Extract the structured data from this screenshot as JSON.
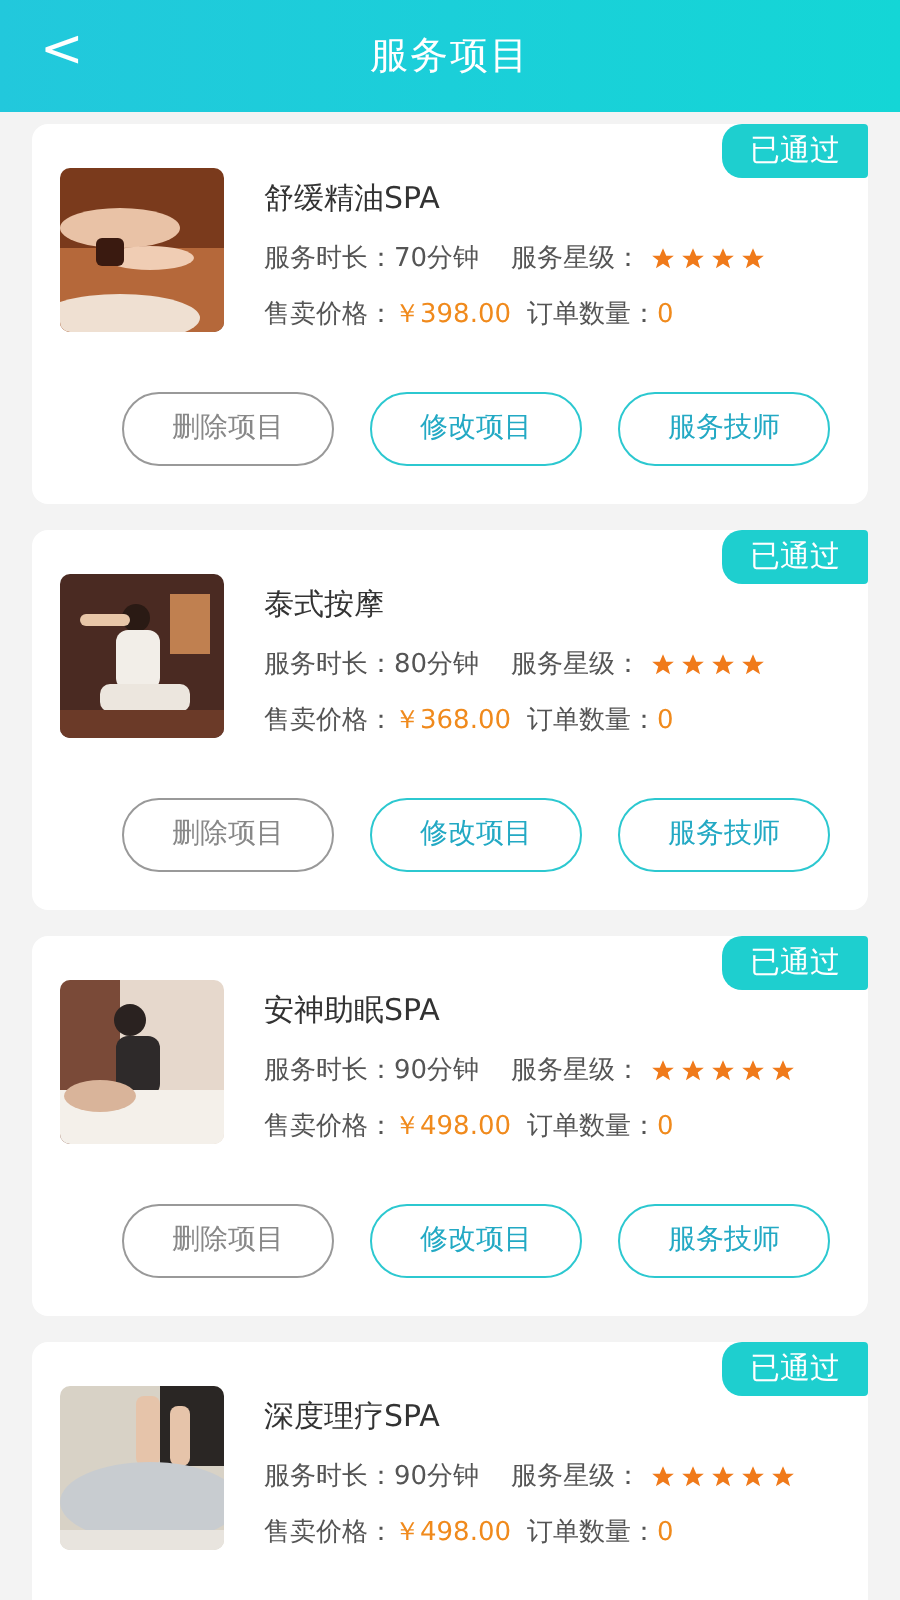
{
  "header": {
    "back": "<",
    "title": "服务项目"
  },
  "items": [
    {
      "status": "已通过",
      "name": "舒缓精油SPA",
      "duration_label": "服务时长：",
      "duration": "70分钟",
      "stars_label": "服务星级：",
      "stars": 4,
      "price_label": "售卖价格：",
      "price": "￥398.00",
      "orders_label": "订单数量：",
      "orders": "0",
      "buttons": [
        {
          "label": "删除项目",
          "kind": "delete"
        },
        {
          "label": "修改项目",
          "kind": "edit"
        },
        {
          "label": "服务技师",
          "kind": "staff"
        }
      ]
    },
    {
      "status": "已通过",
      "name": "泰式按摩",
      "duration_label": "服务时长：",
      "duration": "80分钟",
      "stars_label": "服务星级：",
      "stars": 4,
      "price_label": "售卖价格：",
      "price": "￥368.00",
      "orders_label": "订单数量：",
      "orders": "0",
      "buttons": [
        {
          "label": "删除项目",
          "kind": "delete"
        },
        {
          "label": "修改项目",
          "kind": "edit"
        },
        {
          "label": "服务技师",
          "kind": "staff"
        }
      ]
    },
    {
      "status": "已通过",
      "name": "安神助眠SPA",
      "duration_label": "服务时长：",
      "duration": "90分钟",
      "stars_label": "服务星级：",
      "stars": 5,
      "price_label": "售卖价格：",
      "price": "￥498.00",
      "orders_label": "订单数量：",
      "orders": "0",
      "buttons": [
        {
          "label": "删除项目",
          "kind": "delete"
        },
        {
          "label": "修改项目",
          "kind": "edit"
        },
        {
          "label": "服务技师",
          "kind": "staff"
        }
      ]
    },
    {
      "status": "已通过",
      "name": "深度理疗SPA",
      "duration_label": "服务时长：",
      "duration": "90分钟",
      "stars_label": "服务星级：",
      "stars": 5,
      "price_label": "售卖价格：",
      "price": "￥498.00",
      "orders_label": "订单数量：",
      "orders": "0"
    }
  ]
}
